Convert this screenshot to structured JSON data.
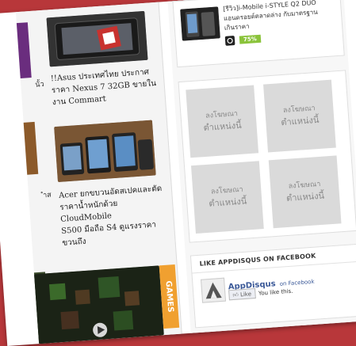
{
  "left_posts": [
    {
      "title_lines": [
        "!!Asus ประเทศไทย ประกาศ",
        "ราคา Nexus 7 32GB ขายใน",
        "งาน Commart"
      ]
    },
    {
      "title_lines": [
        "Acer ยกขบวนอัดสเปคและตัด",
        "ราคาน้ำหนักด้วย CloudMobile",
        "S500 มือถือ S4 ดูแรงราคา",
        "ขวนถึง"
      ]
    }
  ],
  "left_edge_fragments": [
    "นั้ว",
    "ำส"
  ],
  "review": {
    "title_lines": [
      "[รีวิว]i-Mobile i-STYLE Q2 DUO",
      "แอนดรอยด์ตลาดล่าง กับมาตรฐาน",
      "เกินราคา"
    ],
    "score": "75%"
  },
  "ads": [
    {
      "line1": "ลงโฆษณา",
      "line2": "ตำแหน่งนี้"
    },
    {
      "line1": "ลงโฆษณา",
      "line2": "ตำแหน่งนี้"
    },
    {
      "line1": "ลงโฆษณา",
      "line2": "ตำแหน่งนี้"
    },
    {
      "line1": "ลงโฆษณา",
      "line2": "ตำแหน่งนี้"
    }
  ],
  "facebook": {
    "title": "LIKE APPDISQUS ON FACEBOOK",
    "page_name": "AppDisqus",
    "on_facebook": "on Facebook",
    "like_button": "Like",
    "like_status": "You like this."
  },
  "games_label": "GAMES",
  "colors": {
    "background": "#b8373a",
    "score_badge": "#8ac33a",
    "facebook_blue": "#3b5998",
    "games_tab": "#f0a030"
  }
}
